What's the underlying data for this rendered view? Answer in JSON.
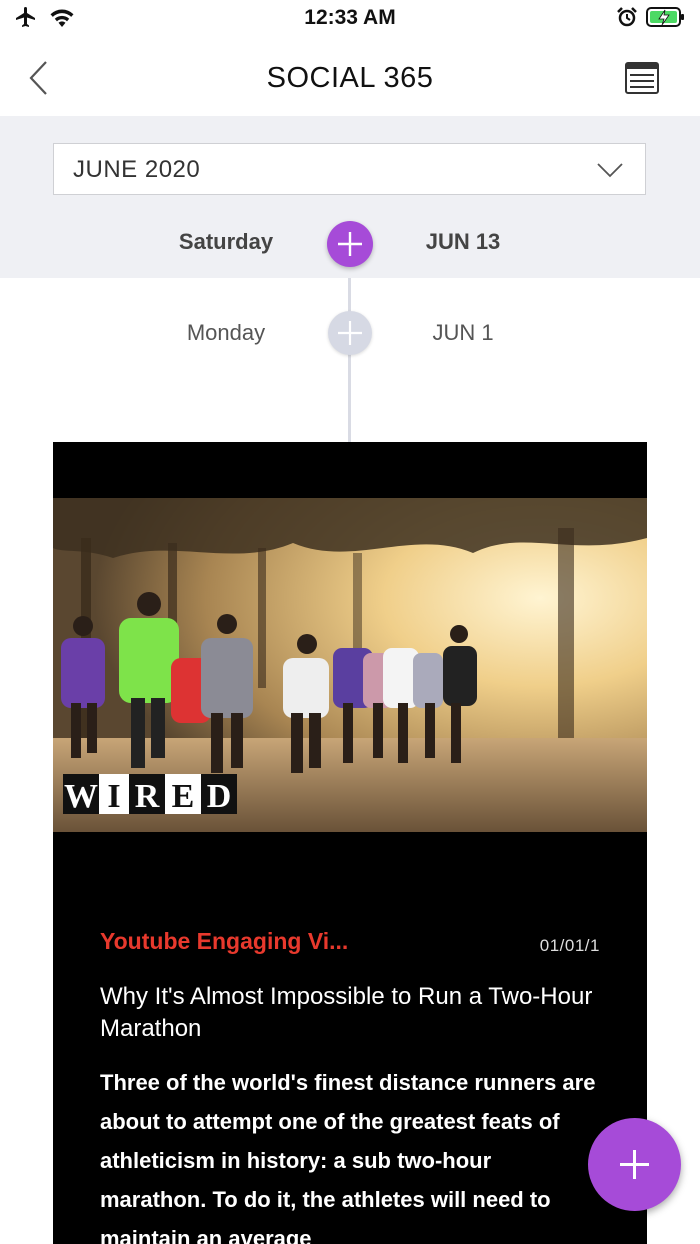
{
  "status_bar": {
    "time": "12:33 AM",
    "icons": [
      "airplane-icon",
      "wifi-icon",
      "alarm-icon",
      "battery-charging-icon"
    ]
  },
  "nav": {
    "title": "SOCIAL 365",
    "left_icon": "chevron-left-icon",
    "right_icon": "calendar-view-icon"
  },
  "month_selector": {
    "value": "JUNE 2020",
    "icon": "chevron-down-icon"
  },
  "timeline": {
    "selected": {
      "day": "Saturday",
      "date": "JUN 13"
    },
    "entries": [
      {
        "day": "Monday",
        "date": "JUN 1"
      }
    ]
  },
  "post_card": {
    "source": "Youtube Engaging Vi...",
    "date": "01/01/1",
    "title": "Why It's Almost Impossible to Run a Two-Hour Marathon",
    "description": "Three of the world's finest distance runners are about to attempt one of the greatest feats of athleticism in history: a sub two-hour marathon. To do it, the athletes will need to maintain an average",
    "thumbnail_logo": "WIRED"
  },
  "colors": {
    "accent_purple": "#a64bd8",
    "source_red": "#e8392d",
    "header_gray": "#eff0f4"
  }
}
